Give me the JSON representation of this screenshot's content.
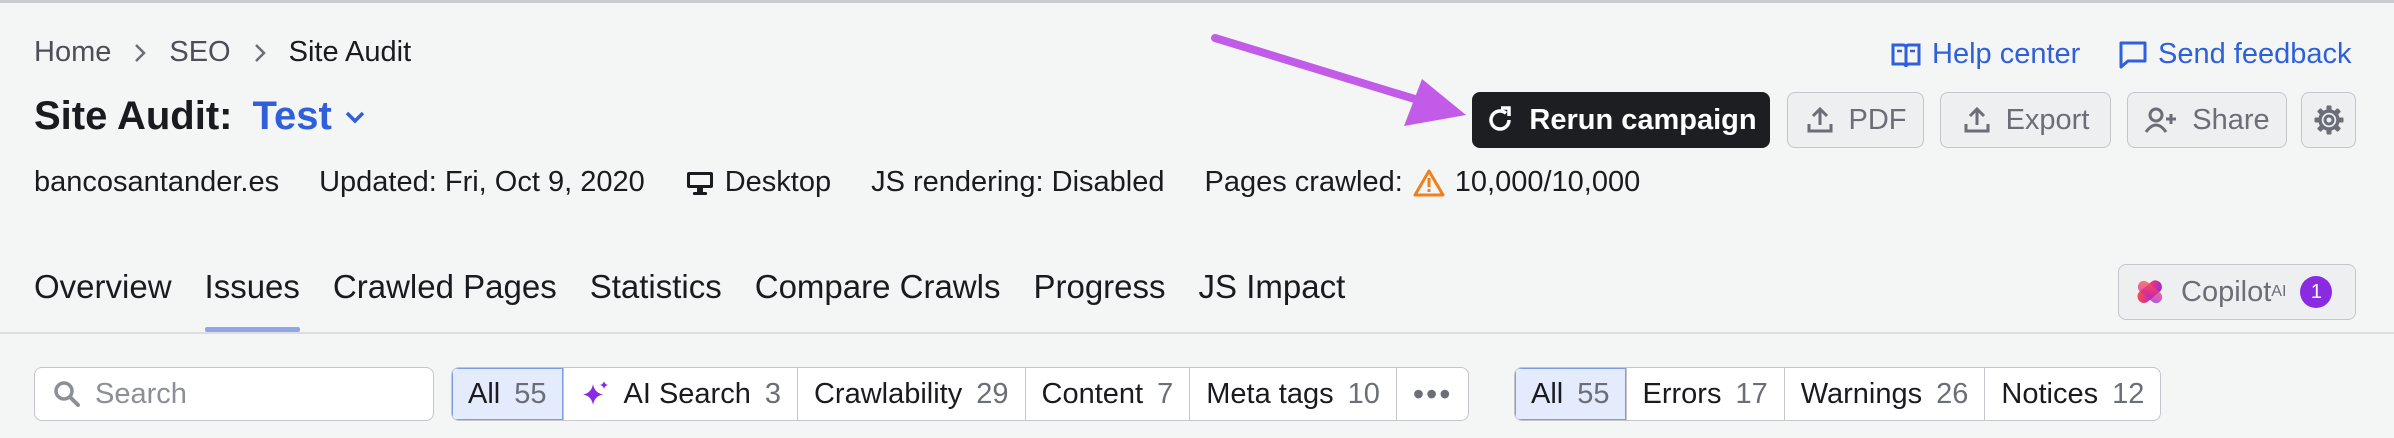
{
  "breadcrumb": {
    "items": [
      "Home",
      "SEO",
      "Site Audit"
    ]
  },
  "title": {
    "label": "Site Audit:",
    "project": "Test"
  },
  "meta": {
    "domain": "bancosantander.es",
    "updated": "Updated: Fri, Oct 9, 2020",
    "device": "Desktop",
    "js_rendering": "JS rendering: Disabled",
    "pages_crawled_label": "Pages crawled:",
    "pages_crawled_value": "10,000/10,000"
  },
  "links": {
    "help": "Help center",
    "feedback": "Send feedback"
  },
  "actions": {
    "rerun": "Rerun campaign",
    "pdf": "PDF",
    "export": "Export",
    "share": "Share"
  },
  "tabs": [
    {
      "label": "Overview"
    },
    {
      "label": "Issues"
    },
    {
      "label": "Crawled Pages"
    },
    {
      "label": "Statistics"
    },
    {
      "label": "Compare Crawls"
    },
    {
      "label": "Progress"
    },
    {
      "label": "JS Impact"
    }
  ],
  "copilot": {
    "label": "Copilot",
    "sup": "AI",
    "badge": "1"
  },
  "search": {
    "placeholder": "Search"
  },
  "category_filters": [
    {
      "label": "All",
      "count": "55"
    },
    {
      "label": "AI Search",
      "count": "3"
    },
    {
      "label": "Crawlability",
      "count": "29"
    },
    {
      "label": "Content",
      "count": "7"
    },
    {
      "label": "Meta tags",
      "count": "10"
    },
    {
      "label": "•••"
    }
  ],
  "severity_filters": [
    {
      "label": "All",
      "count": "55"
    },
    {
      "label": "Errors",
      "count": "17"
    },
    {
      "label": "Warnings",
      "count": "26"
    },
    {
      "label": "Notices",
      "count": "12"
    }
  ],
  "colors": {
    "accent": "#2f5fd9",
    "primary_button": "#1d1e22",
    "annotation_arrow": "#c25ce8",
    "warning": "#f07f1d",
    "copilot_badge": "#8a2be2"
  }
}
